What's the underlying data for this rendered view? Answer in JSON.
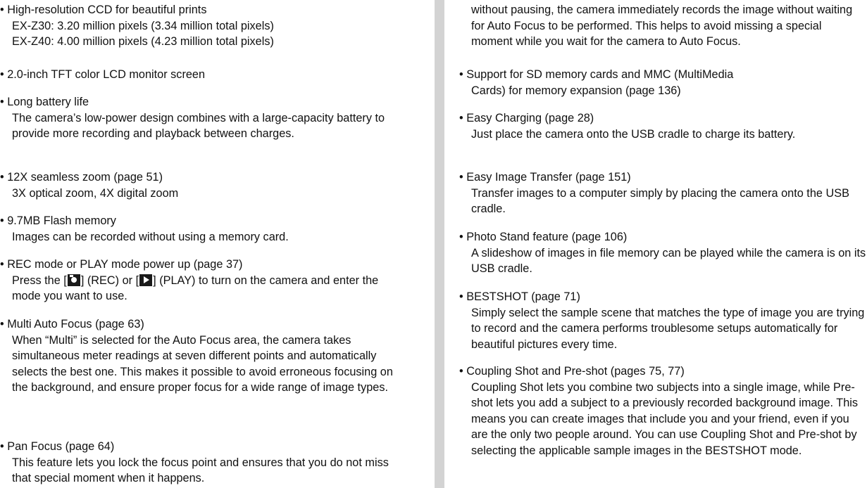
{
  "left": {
    "items": [
      {
        "lead": "• High-resolution CCD for beautiful prints",
        "lines": [
          "EX-Z30: 3.20 million pixels (3.34 million total pixels)",
          "EX-Z40: 4.00 million pixels (4.23 million total pixels)"
        ]
      },
      {
        "lead": "• 2.0-inch TFT color LCD monitor screen",
        "lines": []
      },
      {
        "lead": "• Long battery life",
        "body": "The camera’s low-power design combines with a large-capacity battery to provide more recording and playback between charges."
      },
      {
        "lead": "• 12X seamless zoom (page 51)",
        "lines": [
          "3X optical zoom, 4X digital zoom"
        ]
      },
      {
        "lead": "• 9.7MB Flash memory",
        "lines": [
          "Images can be recorded without using a memory card."
        ]
      },
      {
        "lead": "• REC mode or PLAY mode power up (page 37)",
        "body_a": "Press the [",
        "body_b": "] (REC) or [",
        "body_c": "] (PLAY) to turn on the camera and enter the mode you want to use."
      },
      {
        "lead": "• Multi Auto Focus (page 63)",
        "body": "When “Multi” is selected for the Auto Focus area, the camera takes simultaneous meter readings at seven different points and automatically selects the best one. This makes it possible to avoid erroneous focusing on the background, and ensure proper focus for a wide range of image types."
      },
      {
        "lead": "• Pan Focus (page 64)",
        "body": "This feature lets you lock the focus point and ensures that you do not miss that special moment when it happens."
      }
    ]
  },
  "right": {
    "continuation": "without pausing, the camera immediately records the image without waiting for Auto Focus to be performed. This helps to avoid missing a special moment while you wait for the camera to Auto Focus.",
    "items": [
      {
        "lead": "• Support for SD memory cards and MMC (MultiMedia",
        "body": "Cards) for memory expansion (page 136)"
      },
      {
        "lead": "• Easy Charging (page 28)",
        "body": "Just place the camera onto the USB cradle to charge its battery."
      },
      {
        "lead": "• Easy Image Transfer (page 151)",
        "body": "Transfer images to a computer simply by placing the camera onto the USB cradle."
      },
      {
        "lead": "• Photo Stand feature (page 106)",
        "body": "A slideshow of images in file memory can be played while the camera is on its USB cradle."
      },
      {
        "lead": "• BESTSHOT (page 71)",
        "body": "Simply select the sample scene that matches the type of image you are trying to record and the camera performs troublesome setups automatically for beautiful pictures every time."
      },
      {
        "lead": "• Coupling Shot and Pre-shot (pages 75, 77)",
        "body": "Coupling Shot lets you combine two subjects into a single image, while Pre-shot lets you add a subject to a previously recorded background image. This means you can create images that include you and your friend, even if you are the only two people around. You can use Coupling Shot and Pre-shot by selecting the applicable sample images in the BESTSHOT mode."
      }
    ]
  }
}
